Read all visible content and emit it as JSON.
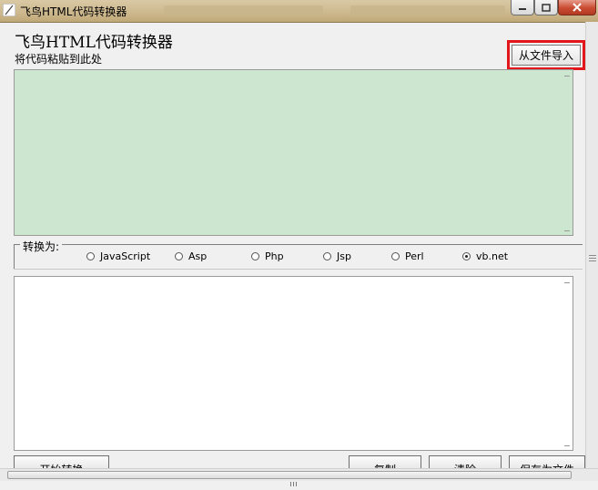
{
  "window": {
    "title": "飞鸟HTML代码转换器",
    "minimize_label": "–",
    "maximize_label": "□",
    "close_label": "✕"
  },
  "header": {
    "app_title": "飞鸟HTML代码转换器",
    "paste_hint": "将代码粘贴到此处",
    "import_button": "从文件导入"
  },
  "convert": {
    "group_label": "转换为:",
    "options": [
      {
        "label": "JavaScript",
        "selected": false
      },
      {
        "label": "Asp",
        "selected": false
      },
      {
        "label": "Php",
        "selected": false
      },
      {
        "label": "Jsp",
        "selected": false
      },
      {
        "label": "Perl",
        "selected": false
      },
      {
        "label": "vb.net",
        "selected": true
      }
    ]
  },
  "input": {
    "value": ""
  },
  "output": {
    "value": ""
  },
  "buttons": {
    "start": "开始转换",
    "copy": "复制",
    "clear": "清除",
    "save": "保存为文件"
  },
  "colors": {
    "input_background": "#cce6cf",
    "highlight": "#e2161b"
  }
}
